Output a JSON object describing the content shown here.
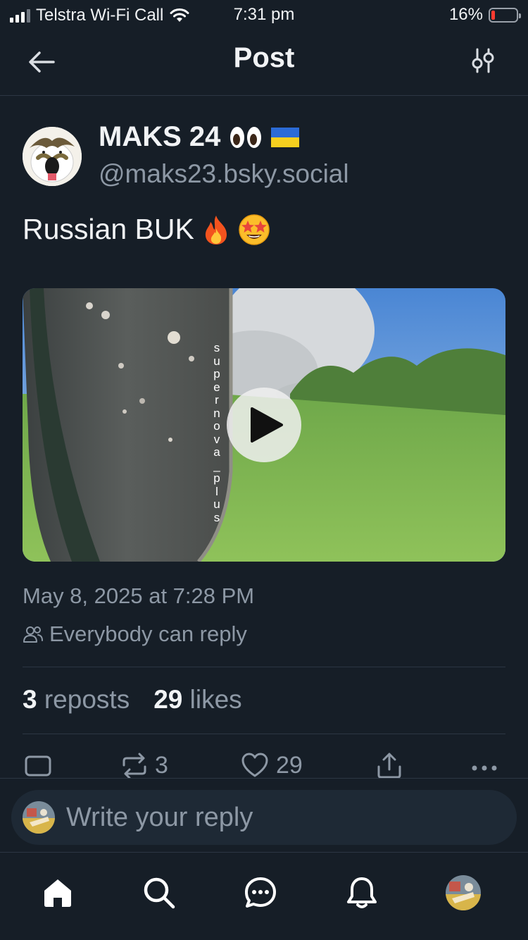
{
  "status_bar": {
    "carrier": "Telstra Wi-Fi Call",
    "time": "7:31 pm",
    "battery_percent": "16%",
    "battery_level": 0.16
  },
  "header": {
    "title": "Post",
    "back_icon": "arrow-left-icon",
    "filter_icon": "sliders-icon"
  },
  "post": {
    "author": {
      "display_name": "MAKS 24",
      "name_emojis": "👀 🇺🇦",
      "handle": "@maks23.bsky.social"
    },
    "text": "Russian BUK",
    "text_emojis": "🔥 🤩",
    "media": {
      "type": "video",
      "watermark": "supernova_plus"
    },
    "timestamp": "May 8, 2025 at 7:28 PM",
    "reply_setting": "Everybody can reply",
    "stats": {
      "reposts_count": "3",
      "reposts_label": "reposts",
      "likes_count": "29",
      "likes_label": "likes"
    },
    "actions": {
      "reply_count": "",
      "repost_count": "3",
      "like_count": "29"
    }
  },
  "composer": {
    "placeholder": "Write your reply"
  },
  "tab_bar": {
    "items": [
      "home-icon",
      "search-icon",
      "chat-icon",
      "bell-icon",
      "profile-avatar"
    ]
  },
  "colors": {
    "background": "#161e27",
    "muted_text": "#8d98a5",
    "divider": "#2c3643",
    "composer_bg": "#1e2935"
  }
}
